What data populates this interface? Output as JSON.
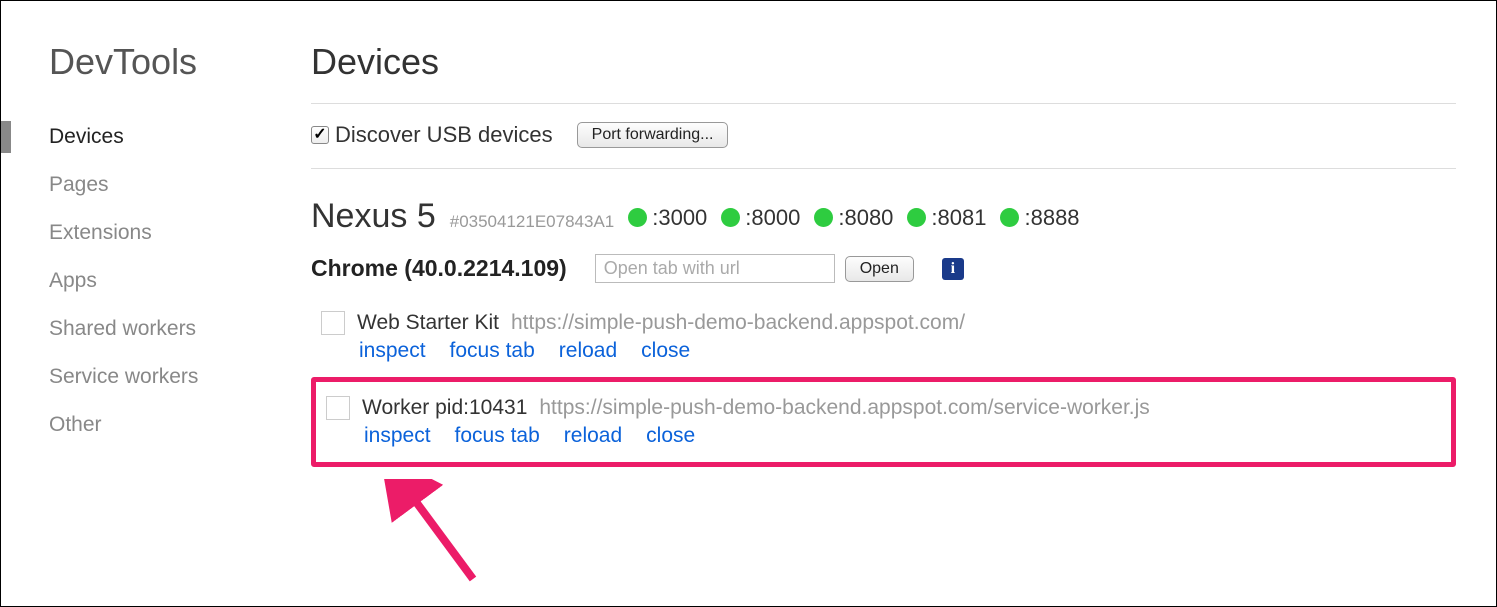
{
  "sidebar": {
    "title": "DevTools",
    "items": [
      {
        "label": "Devices",
        "active": true
      },
      {
        "label": "Pages"
      },
      {
        "label": "Extensions"
      },
      {
        "label": "Apps"
      },
      {
        "label": "Shared workers"
      },
      {
        "label": "Service workers"
      },
      {
        "label": "Other"
      }
    ]
  },
  "page": {
    "title": "Devices",
    "discover_label": "Discover USB devices",
    "discover_checked": true,
    "port_forwarding_label": "Port forwarding..."
  },
  "device": {
    "name": "Nexus 5",
    "id": "#03504121E07843A1",
    "ports": [
      ":3000",
      ":8000",
      ":8080",
      ":8081",
      ":8888"
    ]
  },
  "browser": {
    "name": "Chrome (40.0.2214.109)",
    "url_placeholder": "Open tab with url",
    "open_label": "Open"
  },
  "tabs": [
    {
      "title": "Web Starter Kit",
      "url": "https://simple-push-demo-backend.appspot.com/",
      "actions": {
        "inspect": "inspect",
        "focus": "focus tab",
        "reload": "reload",
        "close": "close"
      }
    },
    {
      "title": "Worker pid:10431",
      "url": "https://simple-push-demo-backend.appspot.com/service-worker.js",
      "actions": {
        "inspect": "inspect",
        "focus": "focus tab",
        "reload": "reload",
        "close": "close"
      },
      "highlight": true
    }
  ]
}
